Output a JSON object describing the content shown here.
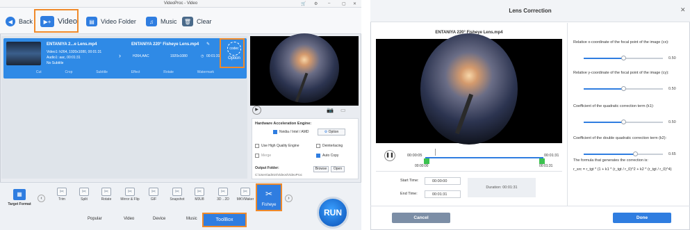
{
  "app": {
    "title": "VideoProc - Video",
    "toolbar": {
      "back": "Back",
      "video": "Video",
      "video_folder": "Video Folder",
      "music": "Music",
      "clear": "Clear"
    },
    "file": {
      "name_short": "ENTANIYA 2...e Lens.mp4",
      "name_out": "ENTANIYA 220° Fisheye Lens.mp4",
      "video_info": "Video1: h264, 1920x1080, 00:01:31",
      "audio_info": "Audio1: aac, 00:01:31",
      "subtitle_info": "No Subtitle",
      "out_codec": "H264,AAC",
      "out_res": "1920x1080",
      "out_dur": "00:01:31",
      "option": "Option",
      "codec_badge": "codec",
      "actions": [
        "Cut",
        "Crop",
        "Subtitle",
        "Effect",
        "Rotate",
        "Watermark"
      ]
    },
    "hw": {
      "title": "Hardware Acceleration Engine:",
      "vendors": "Nvidia / Intel / AMD",
      "option": "Option",
      "high_quality": "Use High Quality Engine",
      "deinterlacing": "Deinterlacing",
      "merge": "Merge",
      "auto_copy": "Auto Copy",
      "output_folder_label": "Output Folder:",
      "output_path": "C:\\Users\\admin\\Videos\\VideoProc",
      "browse": "Browse",
      "open": "Open"
    },
    "target_format": "Target Format",
    "tools": [
      "Trim",
      "Split",
      "Rotate",
      "Mirror & Flip",
      "GIF",
      "Snapshot",
      "M3U8",
      "3D→2D",
      "MKVMaker",
      "Fisheye"
    ],
    "tabs": [
      "Popular",
      "Video",
      "Device",
      "Music",
      "ToolBox"
    ],
    "run": "RUN"
  },
  "dialog": {
    "title": "Lens Correction",
    "video_title": "ENTANIYA 220° Fisheye Lens.mp4",
    "time_current": "00:00:05",
    "time_total": "00:01:31",
    "range_start": "00:00:00",
    "range_end": "00:01:31",
    "start_label": "Start Time:",
    "start_value": "00:00:00",
    "end_label": "End Time:",
    "end_value": "00:01:31",
    "duration": "Duration: 00:01:31",
    "params": [
      {
        "label": "Relative x-coordinate of the focal point of the image (cx):",
        "value": "0.50",
        "fraction": 0.5
      },
      {
        "label": "Relative y-coordinate of the focal point of the image (cy):",
        "value": "0.50",
        "fraction": 0.5
      },
      {
        "label": "Coefficient of the quadratic correction term (k1):",
        "value": "0.50",
        "fraction": 0.5
      },
      {
        "label": "Coefficient of the double quadratic correction term (k2):",
        "value": "0.65",
        "fraction": 0.65
      }
    ],
    "formula_label": "The formula that generates the correction is:",
    "formula": "r_src = r_tgt * (1 + k1 * (r_tgt / r_0)^2 + k2 * (r_tgt / r_0)^4)",
    "cancel": "Cancel",
    "done": "Done"
  }
}
